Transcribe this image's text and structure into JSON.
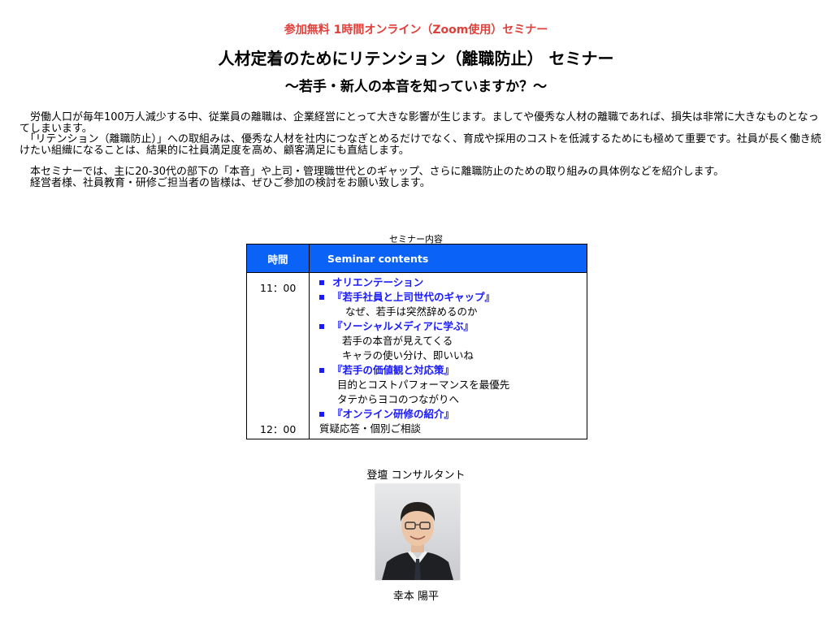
{
  "header": {
    "kicker": "参加無料 1時間オンライン（Zoom使用）セミナー",
    "title": "人材定着のためにリテンション（離職防止） セミナー",
    "subtitle": "～若手・新人の本音を知っていますか？～"
  },
  "intro": {
    "p1": "　労働人口が毎年100万人減少する中、従業員の離職は、企業経営にとって大きな影響が生じます。ましてや優秀な人材の離職であれば、損失は非常に大きなものとなってしまいます。",
    "p2": "　「リテンション（離職防止）」への取組みは、優秀な人材を社内につなぎとめるだけでなく、育成や採用のコストを低減するためにも極めて重要です。社員が長く働き続けたい組織になることは、結果的に社員満足度を高め、顧客満足にも直結します。",
    "p3": "　本セミナーでは、主に20-30代の部下の「本音」や上司・管理職世代とのギャップ、さらに離職防止のための取り組みの具体例などを紹介します。",
    "p4": "　経営者様、社員教育・研修ご担当者の皆様は、ぜひご参加の検討をお願い致します。"
  },
  "table": {
    "caption": "セミナー内容",
    "header_time": "時間",
    "header_contents": "Seminar contents",
    "time_start": "11：00",
    "time_end": "12：00",
    "lines": [
      "オリエンテーション",
      "『若手社員と上司世代のギャップ』",
      "なぜ、若手は突然辞めるのか",
      "『ソーシャルメディアに学ぶ』",
      "若手の本音が見えてくる",
      "キャラの使い分け、即いいね",
      "『若手の価値観と対応策』",
      "目的とコストパフォーマンスを最優先",
      "タテからヨコのつながりへ",
      "『オンライン研修の紹介』",
      "質疑応答・個別ご相談"
    ]
  },
  "consultant": {
    "label": "登壇 コンサルタント",
    "name": "幸本 陽平"
  },
  "colors": {
    "kicker": "#e0403a",
    "table_header_bg": "#0a63f6",
    "topic_text": "#1a1aff"
  }
}
